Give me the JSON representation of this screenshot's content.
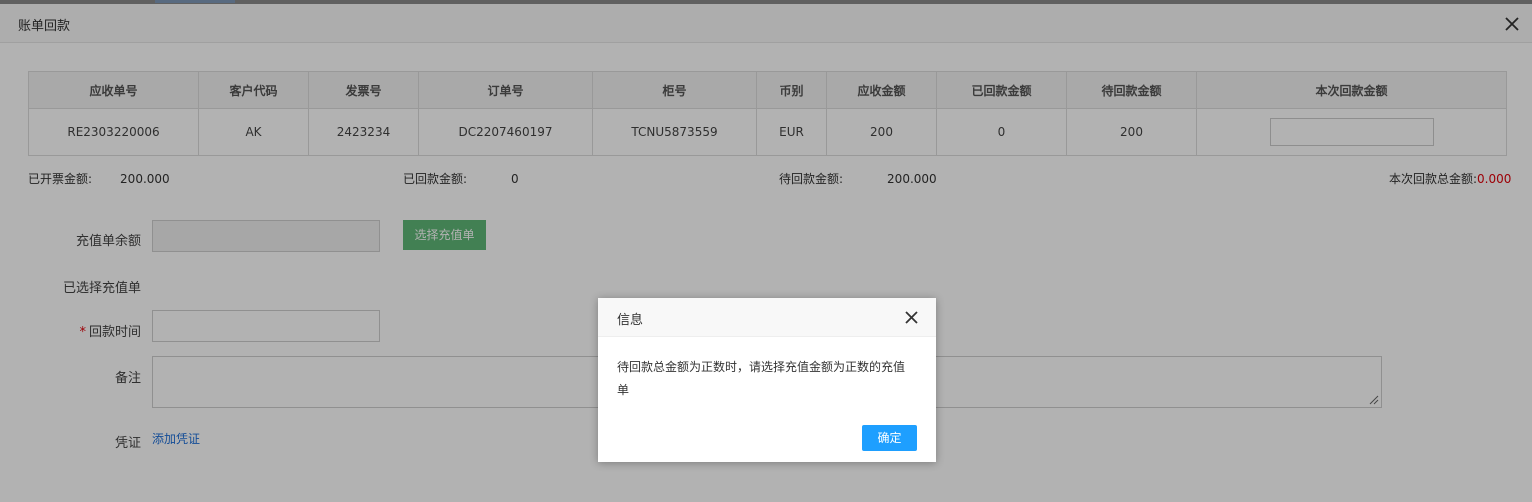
{
  "window": {
    "title": "账单回款"
  },
  "table": {
    "headers": [
      "应收单号",
      "客户代码",
      "发票号",
      "订单号",
      "柜号",
      "币别",
      "应收金额",
      "已回款金额",
      "待回款金额",
      "本次回款金额"
    ],
    "rows": [
      {
        "receivable_no": "RE2303220006",
        "customer_code": "AK",
        "invoice_no": "2423234",
        "order_no": "DC2207460197",
        "container_no": "TCNU5873559",
        "currency": "EUR",
        "receivable_amount": "200",
        "received_amount": "0",
        "pending_amount": "200",
        "current_amount": ""
      }
    ]
  },
  "summary": {
    "invoiced_label": "已开票金额:",
    "invoiced_value": "200.000",
    "received_label": "已回款金额:",
    "received_value": "0",
    "pending_label": "待回款金额:",
    "pending_value": "200.000",
    "current_total_label": "本次回款总金额:",
    "current_total_value": "0.000"
  },
  "form": {
    "recharge_balance_label": "充值单余额",
    "select_recharge_button": "选择充值单",
    "selected_recharge_label": "已选择充值单",
    "required_mark": "*",
    "payment_time_label": "回款时间",
    "remark_label": "备注",
    "voucher_label": "凭证",
    "add_voucher_link": "添加凭证"
  },
  "dialog": {
    "title": "信息",
    "message": "待回款总金额为正数时，请选择充值金额为正数的充值单",
    "ok_button": "确定"
  },
  "colors": {
    "accent": "#1e9fff",
    "green_button": "#5fb878",
    "danger": "#e0000a",
    "link": "#1e6fd9"
  },
  "icons": [
    "close-icon",
    "dialog-close-icon",
    "resize-grip-icon"
  ]
}
